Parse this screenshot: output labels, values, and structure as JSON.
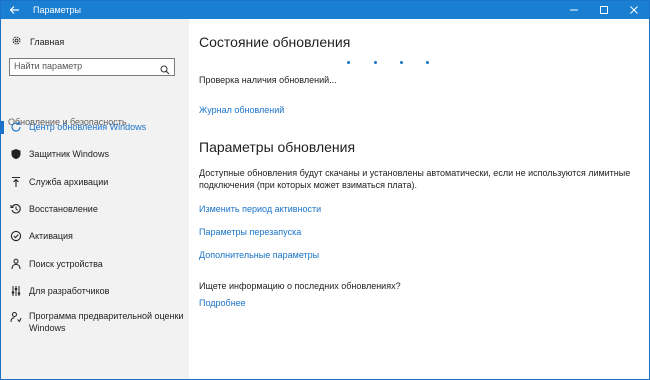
{
  "titlebar": {
    "title": "Параметры",
    "back_icon": "back-arrow-icon",
    "minimize": "—",
    "maximize": "☐",
    "close": "✕",
    "color": "#1a7fd1"
  },
  "sidebar": {
    "home_label": "Главная",
    "search_placeholder": "Найти параметр",
    "section_header": "Обновление и безопасность",
    "items": [
      {
        "label": "Центр обновления Windows",
        "icon": "refresh-icon",
        "active": true
      },
      {
        "label": "Защитник Windows",
        "icon": "shield-icon",
        "active": false
      },
      {
        "label": "Служба архивации",
        "icon": "upload-icon",
        "active": false
      },
      {
        "label": "Восстановление",
        "icon": "history-icon",
        "active": false
      },
      {
        "label": "Активация",
        "icon": "checkmark-circle-icon",
        "active": false
      },
      {
        "label": "Поиск устройства",
        "icon": "person-pin-icon",
        "active": false
      },
      {
        "label": "Для разработчиков",
        "icon": "sliders-icon",
        "active": false
      },
      {
        "label": "Программа предварительной оценки Windows",
        "icon": "insider-icon",
        "active": false
      }
    ]
  },
  "main": {
    "status_title": "Состояние обновления",
    "checking_text": "Проверка наличия обновлений...",
    "history_link": "Журнал обновлений",
    "settings_title": "Параметры обновления",
    "settings_desc_line1": "Доступные обновления будут скачаны и установлены автоматически, если не используются лимитные",
    "settings_desc_line2": "подключения (при которых может взиматься плата).",
    "active_hours_link": "Изменить период активности",
    "restart_link": "Параметры перезапуска",
    "advanced_link": "Дополнительные параметры",
    "question_text": "Ищете информацию о последних обновлениях?",
    "more_link": "Подробнее"
  },
  "colors": {
    "accent": "#1a73c9",
    "sidebar_bg": "#f2f2f2"
  }
}
